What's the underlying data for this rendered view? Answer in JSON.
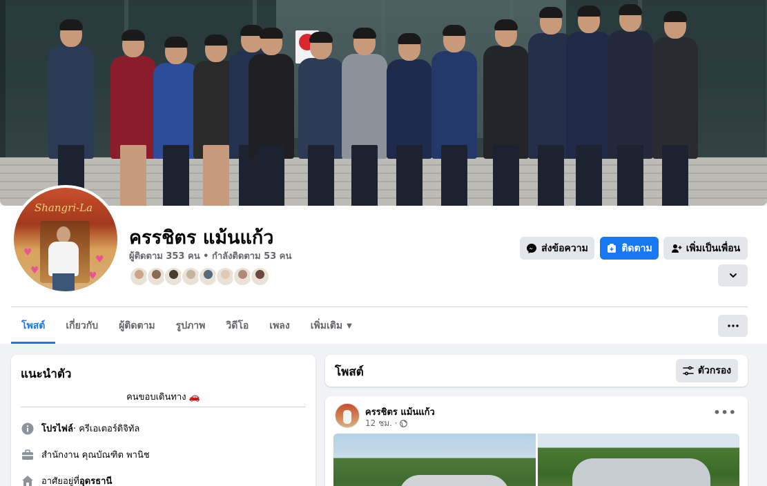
{
  "profile": {
    "name": "ครรชิตร แม้นแก้ว",
    "stats": "ผู้ติดตาม 353 คน • กำลังติดตาม 53 คน",
    "follower_avatar_colors": [
      "#caa48c",
      "#8d6b52",
      "#4a3b30",
      "#c6b39d",
      "#59697c",
      "#e2c9b3",
      "#b08978",
      "#6a4a3c"
    ],
    "avatar_sign_text": "Shangri-La"
  },
  "actions": {
    "message_label": "ส่งข้อความ",
    "follow_label": "ติดตาม",
    "add_friend_label": "เพิ่มเป็นเพื่อน"
  },
  "tabs": [
    {
      "label": "โพสต์",
      "active": true
    },
    {
      "label": "เกี่ยวกับ",
      "active": false
    },
    {
      "label": "ผู้ติดตาม",
      "active": false
    },
    {
      "label": "รูปภาพ",
      "active": false
    },
    {
      "label": "วิดีโอ",
      "active": false
    },
    {
      "label": "เพลง",
      "active": false
    },
    {
      "label": "เพิ่มเติม",
      "active": false
    }
  ],
  "intro": {
    "title": "แนะนำตัว",
    "bio": "คนขอบเดินทาง 🚗",
    "rows": [
      {
        "icon": "info-icon",
        "label": "โปรไฟล์",
        "value": " · ครีเอเตอร์ดิจิทัล"
      },
      {
        "icon": "briefcase-icon",
        "label": "",
        "value": "สำนักงาน คุณบัณฑิต พานิช"
      },
      {
        "icon": "home-icon",
        "label": "อาศัยอยู่ที่ ",
        "value": "อุดรธานี"
      }
    ]
  },
  "posts": {
    "title": "โพสต์",
    "filter_label": "ตัวกรอง"
  },
  "post": {
    "author": "ครรชิตร แม้นแก้ว",
    "time": "12 ชม. ·",
    "privacy_icon": "globe-icon"
  },
  "colors": {
    "accent": "#1877f2",
    "secondary_text": "#65676b",
    "button_gray": "#e4e6eb",
    "page_bg": "#f0f2f5"
  }
}
